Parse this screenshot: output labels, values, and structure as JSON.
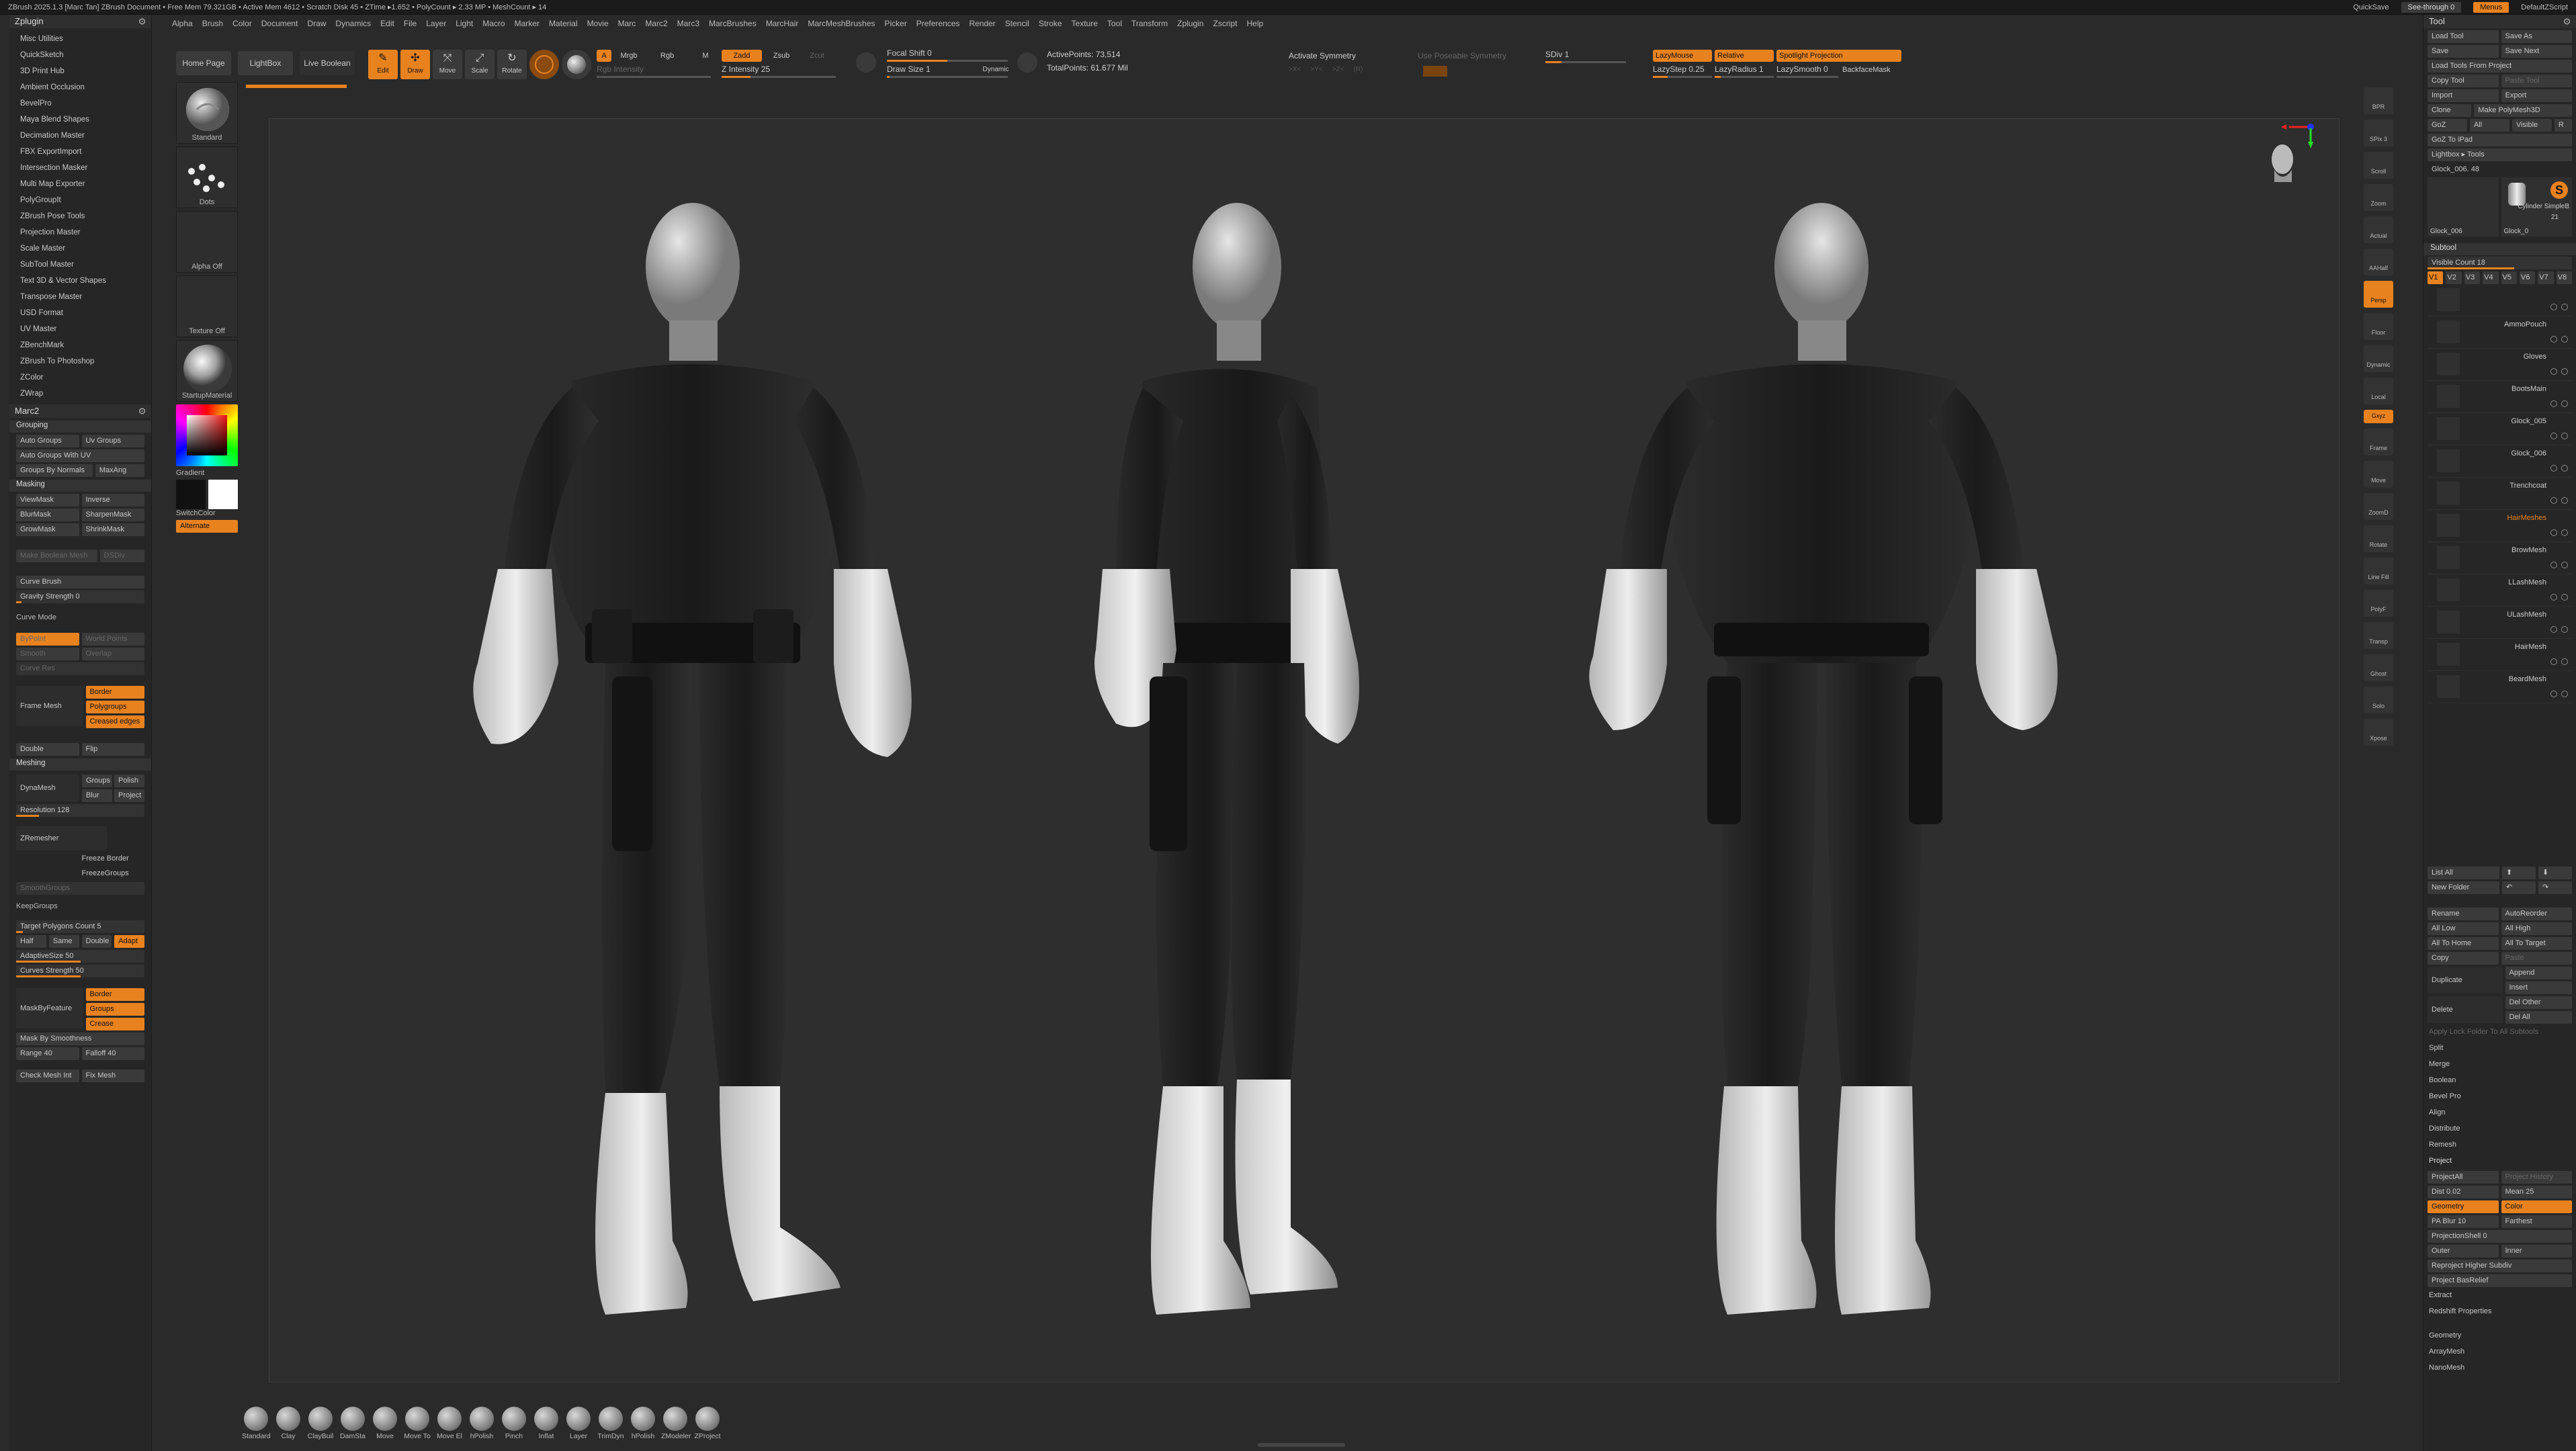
{
  "titlebar": {
    "text": "ZBrush 2025.1.3 [Marc Tan]   ZBrush Document    • Free Mem 79.321GB • Active Mem 4612 • Scratch Disk 45 • ZTime ▸1.652 • PolyCount ▸ 2.33 MP • MeshCount ▸ 14",
    "quicksave": "QuickSave",
    "seethrough": "See-through  0",
    "menus": "Menus",
    "script": "DefaultZScript"
  },
  "menubar": [
    "Alpha",
    "Brush",
    "Color",
    "Document",
    "Draw",
    "Dynamics",
    "Edit",
    "File",
    "Layer",
    "Light",
    "Macro",
    "Marker",
    "Material",
    "Movie",
    "Marc",
    "Marc2",
    "Marc3",
    "MarcBrushes",
    "MarcHair",
    "MarcMeshBrushes",
    "Picker",
    "Preferences",
    "Render",
    "Stencil",
    "Stroke",
    "Texture",
    "Tool",
    "Transform",
    "Zplugin",
    "Zscript",
    "Help"
  ],
  "leftpal": {
    "title": "Zplugin",
    "plugins": [
      "Misc Utilities",
      "QuickSketch",
      "3D Print Hub",
      "Ambient Occlusion",
      "BevelPro",
      "Maya Blend Shapes",
      "Decimation Master",
      "FBX ExportImport",
      "Intersection Masker",
      "Multi Map Exporter",
      "PolyGroupIt",
      "ZBrush Pose Tools",
      "Projection Master",
      "Scale Master",
      "SubTool Master",
      "Text 3D & Vector Shapes",
      "Transpose Master",
      "USD Format",
      "UV Master",
      "ZBenchMark",
      "ZBrush To Photoshop",
      "ZColor",
      "ZWrap"
    ],
    "marc2_title": "Marc2",
    "grouping": "Grouping",
    "auto_groups": "Auto Groups",
    "uv_groups": "Uv Groups",
    "auto_groups_uv": "Auto Groups With UV",
    "groups_by_normals": "Groups By Normals",
    "maxang": "MaxAng",
    "masking": "Masking",
    "viewmask": "ViewMask",
    "inverse": "Inverse",
    "blurmask": "BlurMask",
    "sharpenmask": "SharpenMask",
    "growmask": "GrowMask",
    "shrinkmask": "ShrinkMask",
    "make_boolean_mesh": "Make Boolean Mesh",
    "dsdiv": "DSDiv",
    "curve_brush": "Curve Brush",
    "gravity_strength": "Gravity Strength 0",
    "curve_mode": "Curve Mode",
    "by_point": "ByPoint",
    "world_points": "World Points",
    "smooth": "Smooth",
    "overlap": "Overlap",
    "curve_res": "Curve Res",
    "frame_mesh": "Frame Mesh",
    "border": "Border",
    "polygroups": "Polygroups",
    "creased_edges": "Creased edges",
    "double": "Double",
    "flip": "Flip",
    "meshing": "Meshing",
    "dynamesh": "DynaMesh",
    "groups": "Groups",
    "polish": "Polish",
    "blur": "Blur",
    "project": "Project",
    "resolution": "Resolution 128",
    "zremesher": "ZRemesher",
    "freeze_border": "Freeze Border",
    "freeze_groups": "FreezeGroups",
    "smooth_groups": "SmoothGroups",
    "keep_groups": "KeepGroups",
    "target_poly": "Target Polygons Count 5",
    "half": "Half",
    "same": "Same",
    "double2": "Double",
    "adapt": "Adapt",
    "adaptive_size": "AdaptiveSize 50",
    "curves_strength": "Curves Strength 50",
    "border2": "Border",
    "mask_by_feature": "MaskByFeature",
    "groups2": "Groups",
    "crease": "Crease",
    "mask_by_smoothness": "Mask By Smoothness",
    "range": "Range 40",
    "falloff": "Falloff 40",
    "check_mesh_int": "Check Mesh Int",
    "fix_mesh": "Fix Mesh"
  },
  "leftshelf": {
    "brush": "Standard",
    "stroke": "Dots",
    "alpha": "Alpha Off",
    "texture": "Texture Off",
    "material": "StartupMaterial",
    "gradient": "Gradient",
    "switch_color": "SwitchColor",
    "alternate": "Alternate"
  },
  "toptool": {
    "home_page": "Home Page",
    "lightbox": "LightBox",
    "live_boolean": "Live Boolean",
    "edit": "Edit",
    "draw": "Draw",
    "move": "Move",
    "scale": "Scale",
    "rotate": "Rotate",
    "a": "A",
    "mrgb": "Mrgb",
    "rgb": "Rgb",
    "m": "M",
    "zadd": "Zadd",
    "zsub": "Zsub",
    "zcut": "Zcut",
    "rgb_intensity": "Rgb Intensity",
    "z_intensity": "Z Intensity 25",
    "focal_shift": "Focal Shift 0",
    "draw_size": "Draw Size 1",
    "dynamic": "Dynamic",
    "active_points": "ActivePoints: 73,514",
    "total_points": "TotalPoints: 61.677 Mil",
    "activate_symmetry": "Activate Symmetry",
    "use_poseable_symmetry": "Use Poseable Symmetry",
    "sdiv": "SDiv 1",
    "lazymouse": "LazyMouse",
    "relative": "Relative",
    "spotlight_projection": "Spotlight Projection",
    "lazystep": "LazyStep 0.25",
    "lazyradius": "LazyRadius 1",
    "lazysmooth": "LazySmooth 0",
    "backface_mask": "BackfaceMask"
  },
  "navstrip": [
    "BPR",
    "SPix 3",
    "Scroll",
    "Zoom",
    "Actual",
    "AAHalf",
    "Persp",
    "Floor",
    "Dynamic",
    "Local",
    "Gxyz",
    "Frame",
    "Move",
    "ZoomD",
    "Rotate",
    "Line Fill",
    "PolyF",
    "Transp",
    "Ghost",
    "Solo",
    "Xpose"
  ],
  "rightpal": {
    "title": "Tool",
    "load_tool": "Load Tool",
    "save_as": "Save As",
    "save": "Save",
    "save_next": "Save Next",
    "load_tools_from_project": "Load Tools From Project",
    "copy_tool": "Copy Tool",
    "paste_tool": "Paste Tool",
    "import": "Import",
    "export": "Export",
    "clone": "Clone",
    "make_polymesh": "Make PolyMesh3D",
    "goz": "GoZ",
    "all": "All",
    "visible": "Visible",
    "r": "R",
    "goz_ipad": "GoZ To iPad",
    "lightbox_tools": "Lightbox ▸ Tools",
    "glock": "Glock_006. 48",
    "glock_thumb": "Glock_006",
    "glock_thumb2": "Glock_0",
    "cylinder": "Cylinder SimpleB",
    "cyl_count": "21",
    "subtool": "Subtool",
    "visible_count": "Visible Count 18",
    "v_tabs": [
      "V1",
      "V2",
      "V3",
      "V4",
      "V5",
      "V6",
      "V7",
      "V8"
    ],
    "subtools": [
      {
        "name": ""
      },
      {
        "name": "AmmoPouch"
      },
      {
        "name": "Gloves"
      },
      {
        "name": "BootsMain"
      },
      {
        "name": "Glock_005"
      },
      {
        "name": "Glock_006"
      },
      {
        "name": "Trenchcoat"
      },
      {
        "name": "HairMeshes",
        "active": true
      },
      {
        "name": "BrowMesh"
      },
      {
        "name": "LLashMesh"
      },
      {
        "name": "ULashMesh"
      },
      {
        "name": "HairMesh"
      },
      {
        "name": "BeardMesh"
      }
    ],
    "list_all": "List All",
    "new_folder": "New Folder",
    "rename": "Rename",
    "auto_reorder": "AutoReorder",
    "all_low": "All Low",
    "all_high": "All High",
    "all_to_home": "All To Home",
    "all_to_target": "All To Target",
    "copy": "Copy",
    "paste": "Paste",
    "duplicate": "Duplicate",
    "append": "Append",
    "insert": "Insert",
    "delete": "Delete",
    "del_other": "Del Other",
    "del_all": "Del All",
    "apply_lock": "Apply Lock Folder To All Subtools",
    "split": "Split",
    "merge": "Merge",
    "boolean": "Boolean",
    "bevel_pro": "Bevel Pro",
    "align": "Align",
    "distribute": "Distribute",
    "remesh": "Remesh",
    "project_hdr": "Project",
    "project_all": "ProjectAll",
    "project_history": "Project History",
    "dist": "Dist 0.02",
    "mean": "Mean 25",
    "geometry": "Geometry",
    "color": "Color",
    "pa_blur": "PA Blur 10",
    "farthest": "Farthest",
    "projection_shell": "ProjectionShell 0",
    "outer": "Outer",
    "inner": "Inner",
    "reproject": "Reproject Higher Subdiv",
    "project_basrelief": "Project BasRelief",
    "extract": "Extract",
    "redshift_props": "Redshift Properties",
    "geometry2": "Geometry",
    "arraymesh": "ArrayMesh",
    "nanomesh": "NanoMesh"
  },
  "bottomshelf": [
    "Standard",
    "Clay",
    "ClayBuil",
    "DamSta",
    "Move",
    "Move To",
    "Move El",
    "hPolish",
    "Pinch",
    "Inflat",
    "Layer",
    "TrimDyn",
    "hPolish",
    "ZModeler",
    "ZProject"
  ],
  "colors": {
    "accent": "#e8821f",
    "bg": "#2a2a2a",
    "panel": "#262626",
    "suit": "#1e1e1e",
    "gear": "#d6d6d6",
    "skin": "#b9b9b9"
  }
}
